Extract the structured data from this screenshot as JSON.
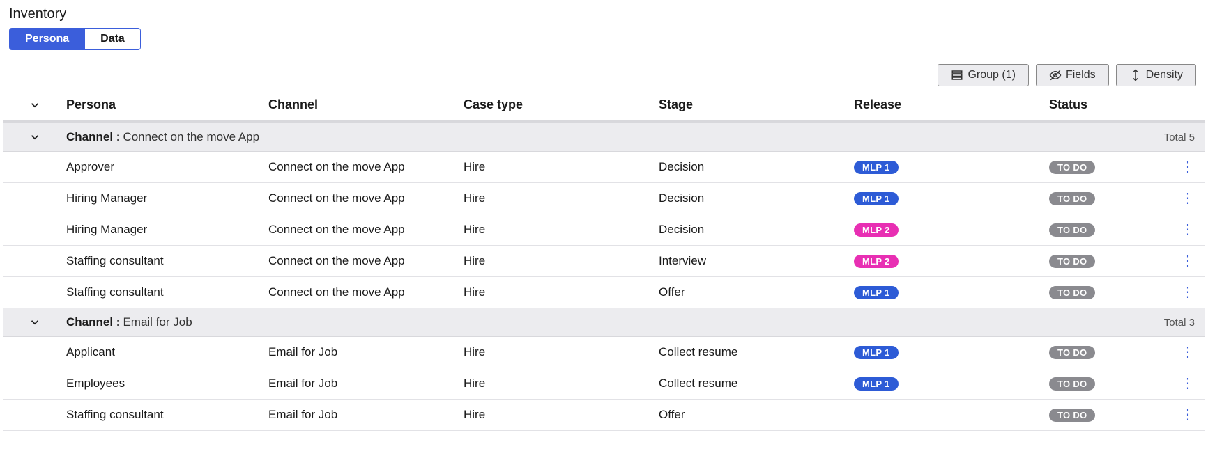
{
  "page_title": "Inventory",
  "tabs": [
    {
      "label": "Persona",
      "active": true
    },
    {
      "label": "Data",
      "active": false
    }
  ],
  "toolbar": {
    "group": "Group (1)",
    "fields": "Fields",
    "density": "Density"
  },
  "columns": {
    "persona": "Persona",
    "channel": "Channel",
    "casetype": "Case type",
    "stage": "Stage",
    "release": "Release",
    "status": "Status"
  },
  "release_colors": {
    "MLP 1": "#2d5bd6",
    "MLP 2": "#e82fb3"
  },
  "status_colors": {
    "TO DO": "#8a8a8f"
  },
  "group_label": "Channel : ",
  "total_label": "Total ",
  "groups": [
    {
      "name": "Connect on the move App",
      "total": 5,
      "rows": [
        {
          "persona": "Approver",
          "channel": "Connect on the move App",
          "casetype": "Hire",
          "stage": "Decision",
          "release": "MLP 1",
          "status": "TO DO"
        },
        {
          "persona": "Hiring Manager",
          "channel": "Connect on the move App",
          "casetype": "Hire",
          "stage": "Decision",
          "release": "MLP 1",
          "status": "TO DO"
        },
        {
          "persona": "Hiring Manager",
          "channel": "Connect on the move App",
          "casetype": "Hire",
          "stage": "Decision",
          "release": "MLP 2",
          "status": "TO DO"
        },
        {
          "persona": "Staffing consultant",
          "channel": "Connect on the move App",
          "casetype": "Hire",
          "stage": "Interview",
          "release": "MLP 2",
          "status": "TO DO"
        },
        {
          "persona": "Staffing consultant",
          "channel": "Connect on the move App",
          "casetype": "Hire",
          "stage": "Offer",
          "release": "MLP 1",
          "status": "TO DO"
        }
      ]
    },
    {
      "name": "Email for Job",
      "total": 3,
      "rows": [
        {
          "persona": "Applicant",
          "channel": "Email for Job",
          "casetype": "Hire",
          "stage": "Collect resume",
          "release": "MLP 1",
          "status": "TO DO"
        },
        {
          "persona": "Employees",
          "channel": "Email for Job",
          "casetype": "Hire",
          "stage": "Collect resume",
          "release": "MLP 1",
          "status": "TO DO"
        },
        {
          "persona": "Staffing consultant",
          "channel": "Email for Job",
          "casetype": "Hire",
          "stage": "Offer",
          "release": "",
          "status": "TO DO"
        }
      ]
    }
  ]
}
